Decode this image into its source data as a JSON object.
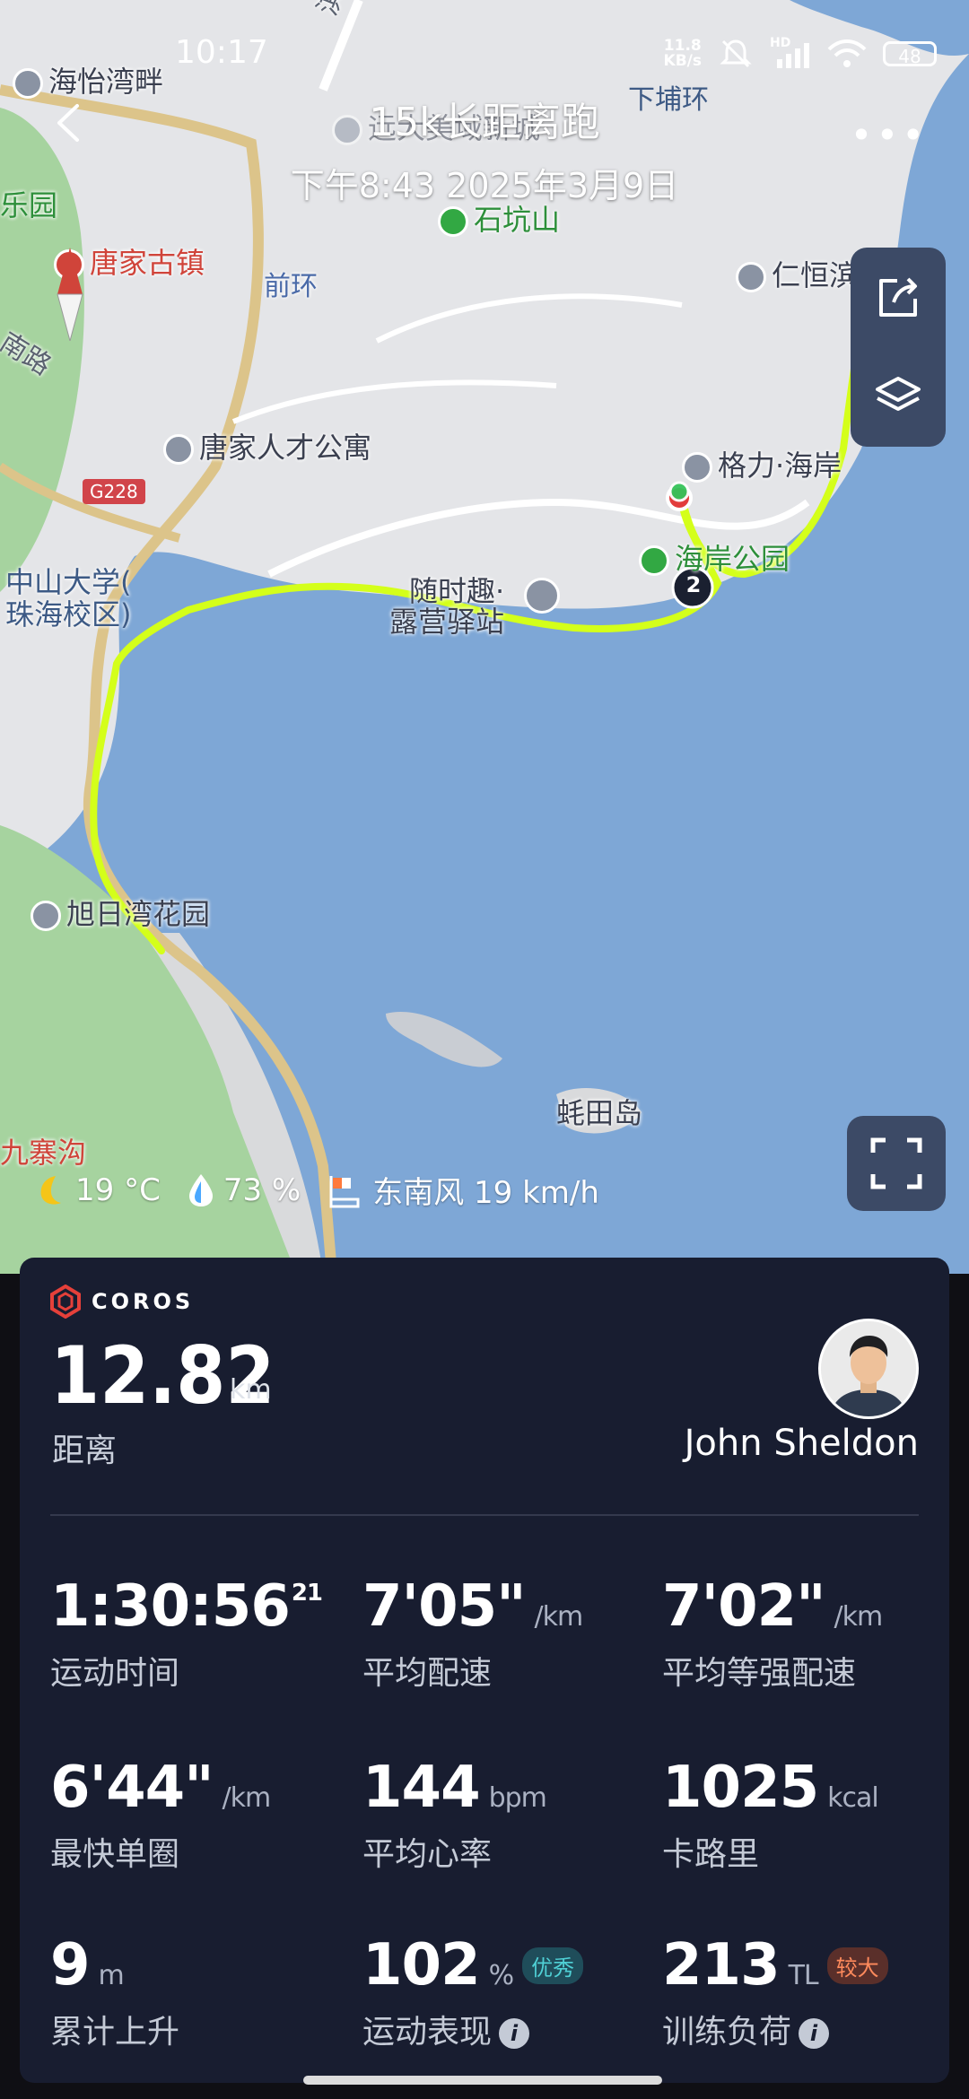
{
  "status_bar": {
    "time": "10:17",
    "net_speed_value": "11.8",
    "net_speed_unit": "KB/s",
    "signal_label": "HD",
    "battery": "48"
  },
  "header": {
    "title": "15k长距离跑",
    "datetime": "下午8:43 2025年3月9日"
  },
  "map": {
    "labels": {
      "haiyi": "海怡湾畔",
      "qi_road": "淇路",
      "xiapuhuan": "下埔环",
      "leyuan": "乐园",
      "yuanda": "远大美域新城",
      "shikengshan": "石坑山",
      "tangjia": "唐家古镇",
      "qianhuan": "前环",
      "renheng": "仁恒滨海半岛",
      "nanlu": "南路",
      "talent": "唐家人才公寓",
      "geli": "格力·海岸",
      "g228": "G228",
      "park": "海岸公园",
      "suishiqu": "随时趣·",
      "yizhan": "露营驿站",
      "zhongshan1": "中山大学(",
      "zhongshan2": "珠海校区)",
      "xuri": "旭日湾花园",
      "qiantiandao": "蚝田岛",
      "jiuzhaigou": "九寨沟"
    },
    "lap_marker": "2"
  },
  "weather": {
    "temperature": "19 °C",
    "humidity": "73  %",
    "wind": "东南风 19 km/h"
  },
  "card": {
    "brand": "COROS",
    "distance_value": "12.82",
    "distance_unit": "km",
    "distance_label": "距离",
    "user_name": "John Sheldon",
    "stats": [
      {
        "value": "1:30:56",
        "sup": "21",
        "unit": "",
        "label": "运动时间"
      },
      {
        "value": "7'05\"",
        "unit": "/km",
        "label": "平均配速"
      },
      {
        "value": "7'02\"",
        "unit": "/km",
        "label": "平均等强配速"
      },
      {
        "value": "6'44\"",
        "unit": "/km",
        "label": "最快单圈"
      },
      {
        "value": "144",
        "unit": "bpm",
        "label": "平均心率"
      },
      {
        "value": "1025",
        "unit": "kcal",
        "label": "卡路里"
      },
      {
        "value": "9",
        "unit": "m",
        "label": "累计上升"
      },
      {
        "value": "102",
        "unit": "%",
        "badge": "优秀",
        "label": "运动表现",
        "info": "i"
      },
      {
        "value": "213",
        "unit": "TL",
        "badge": "较大",
        "label": "训练负荷",
        "info": "i"
      }
    ]
  },
  "colors": {
    "route": "#d4ff1a",
    "card_bg": "#181d30",
    "water": "#7ea7d6",
    "land": "#e6e6e8",
    "green_area": "#9fd09a",
    "badge_good": "#4fd0d5",
    "badge_high": "#ff8a5c"
  }
}
